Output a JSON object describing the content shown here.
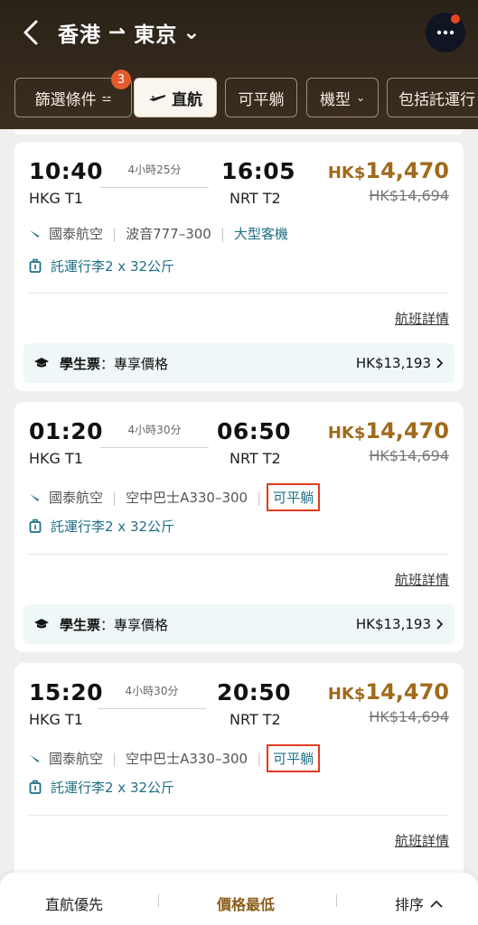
{
  "header": {
    "origin": "香港",
    "arrow": "⇀",
    "destination": "東京",
    "chevron": "⌄",
    "more_icon": "more-icon",
    "back_icon": "back-icon"
  },
  "filters": {
    "badge_count": "3",
    "items": [
      {
        "label": "篩選條件",
        "sub": "⚍"
      },
      {
        "label": "直航",
        "sub": ""
      },
      {
        "label": "可平躺",
        "sub": ""
      },
      {
        "label": "機型",
        "sub": "⌄"
      },
      {
        "label": "包括託運行",
        "sub": ""
      }
    ],
    "direct_icon": "plane-icon"
  },
  "flights": [
    {
      "depart_time": "10:40",
      "depart_airport": "HKG T1",
      "duration": "4小時25分",
      "arrive_time": "16:05",
      "arrive_airport": "NRT T2",
      "currency": "HK$",
      "price": "14,470",
      "old_price": "HK$14,694",
      "airline": "國泰航空",
      "aircraft": "波音777–300",
      "tag": "大型客機",
      "baggage": "託運行李2 x 32公斤",
      "details": "航班詳情",
      "student_label": "學生票",
      "student_desc": "：專享價格",
      "student_price": "HK$13,193"
    },
    {
      "depart_time": "01:20",
      "depart_airport": "HKG T1",
      "duration": "4小時30分",
      "arrive_time": "06:50",
      "arrive_airport": "NRT T2",
      "currency": "HK$",
      "price": "14,470",
      "old_price": "HK$14,694",
      "airline": "國泰航空",
      "aircraft": "空中巴士A330–300",
      "tag": "可平躺",
      "baggage": "託運行李2 x 32公斤",
      "details": "航班詳情",
      "student_label": "學生票",
      "student_desc": "：專享價格",
      "student_price": "HK$13,193"
    },
    {
      "depart_time": "15:20",
      "depart_airport": "HKG T1",
      "duration": "4小時30分",
      "arrive_time": "20:50",
      "arrive_airport": "NRT T2",
      "currency": "HK$",
      "price": "14,470",
      "old_price": "HK$14,694",
      "airline": "國泰航空",
      "aircraft": "空中巴士A330–300",
      "tag": "可平躺",
      "baggage": "託運行李2 x 32公斤",
      "details": "航班詳情"
    }
  ],
  "bottom_bar": {
    "tab1": "直航優先",
    "tab2": "價格最低",
    "tab3": "排序",
    "tab3_icon": "chevron-up-icon"
  },
  "colors": {
    "header_bg": "#2a2218",
    "price": "#a06a1b",
    "link": "#1f6f86",
    "highlight": "#e23b22",
    "badge": "#e35a2b"
  }
}
